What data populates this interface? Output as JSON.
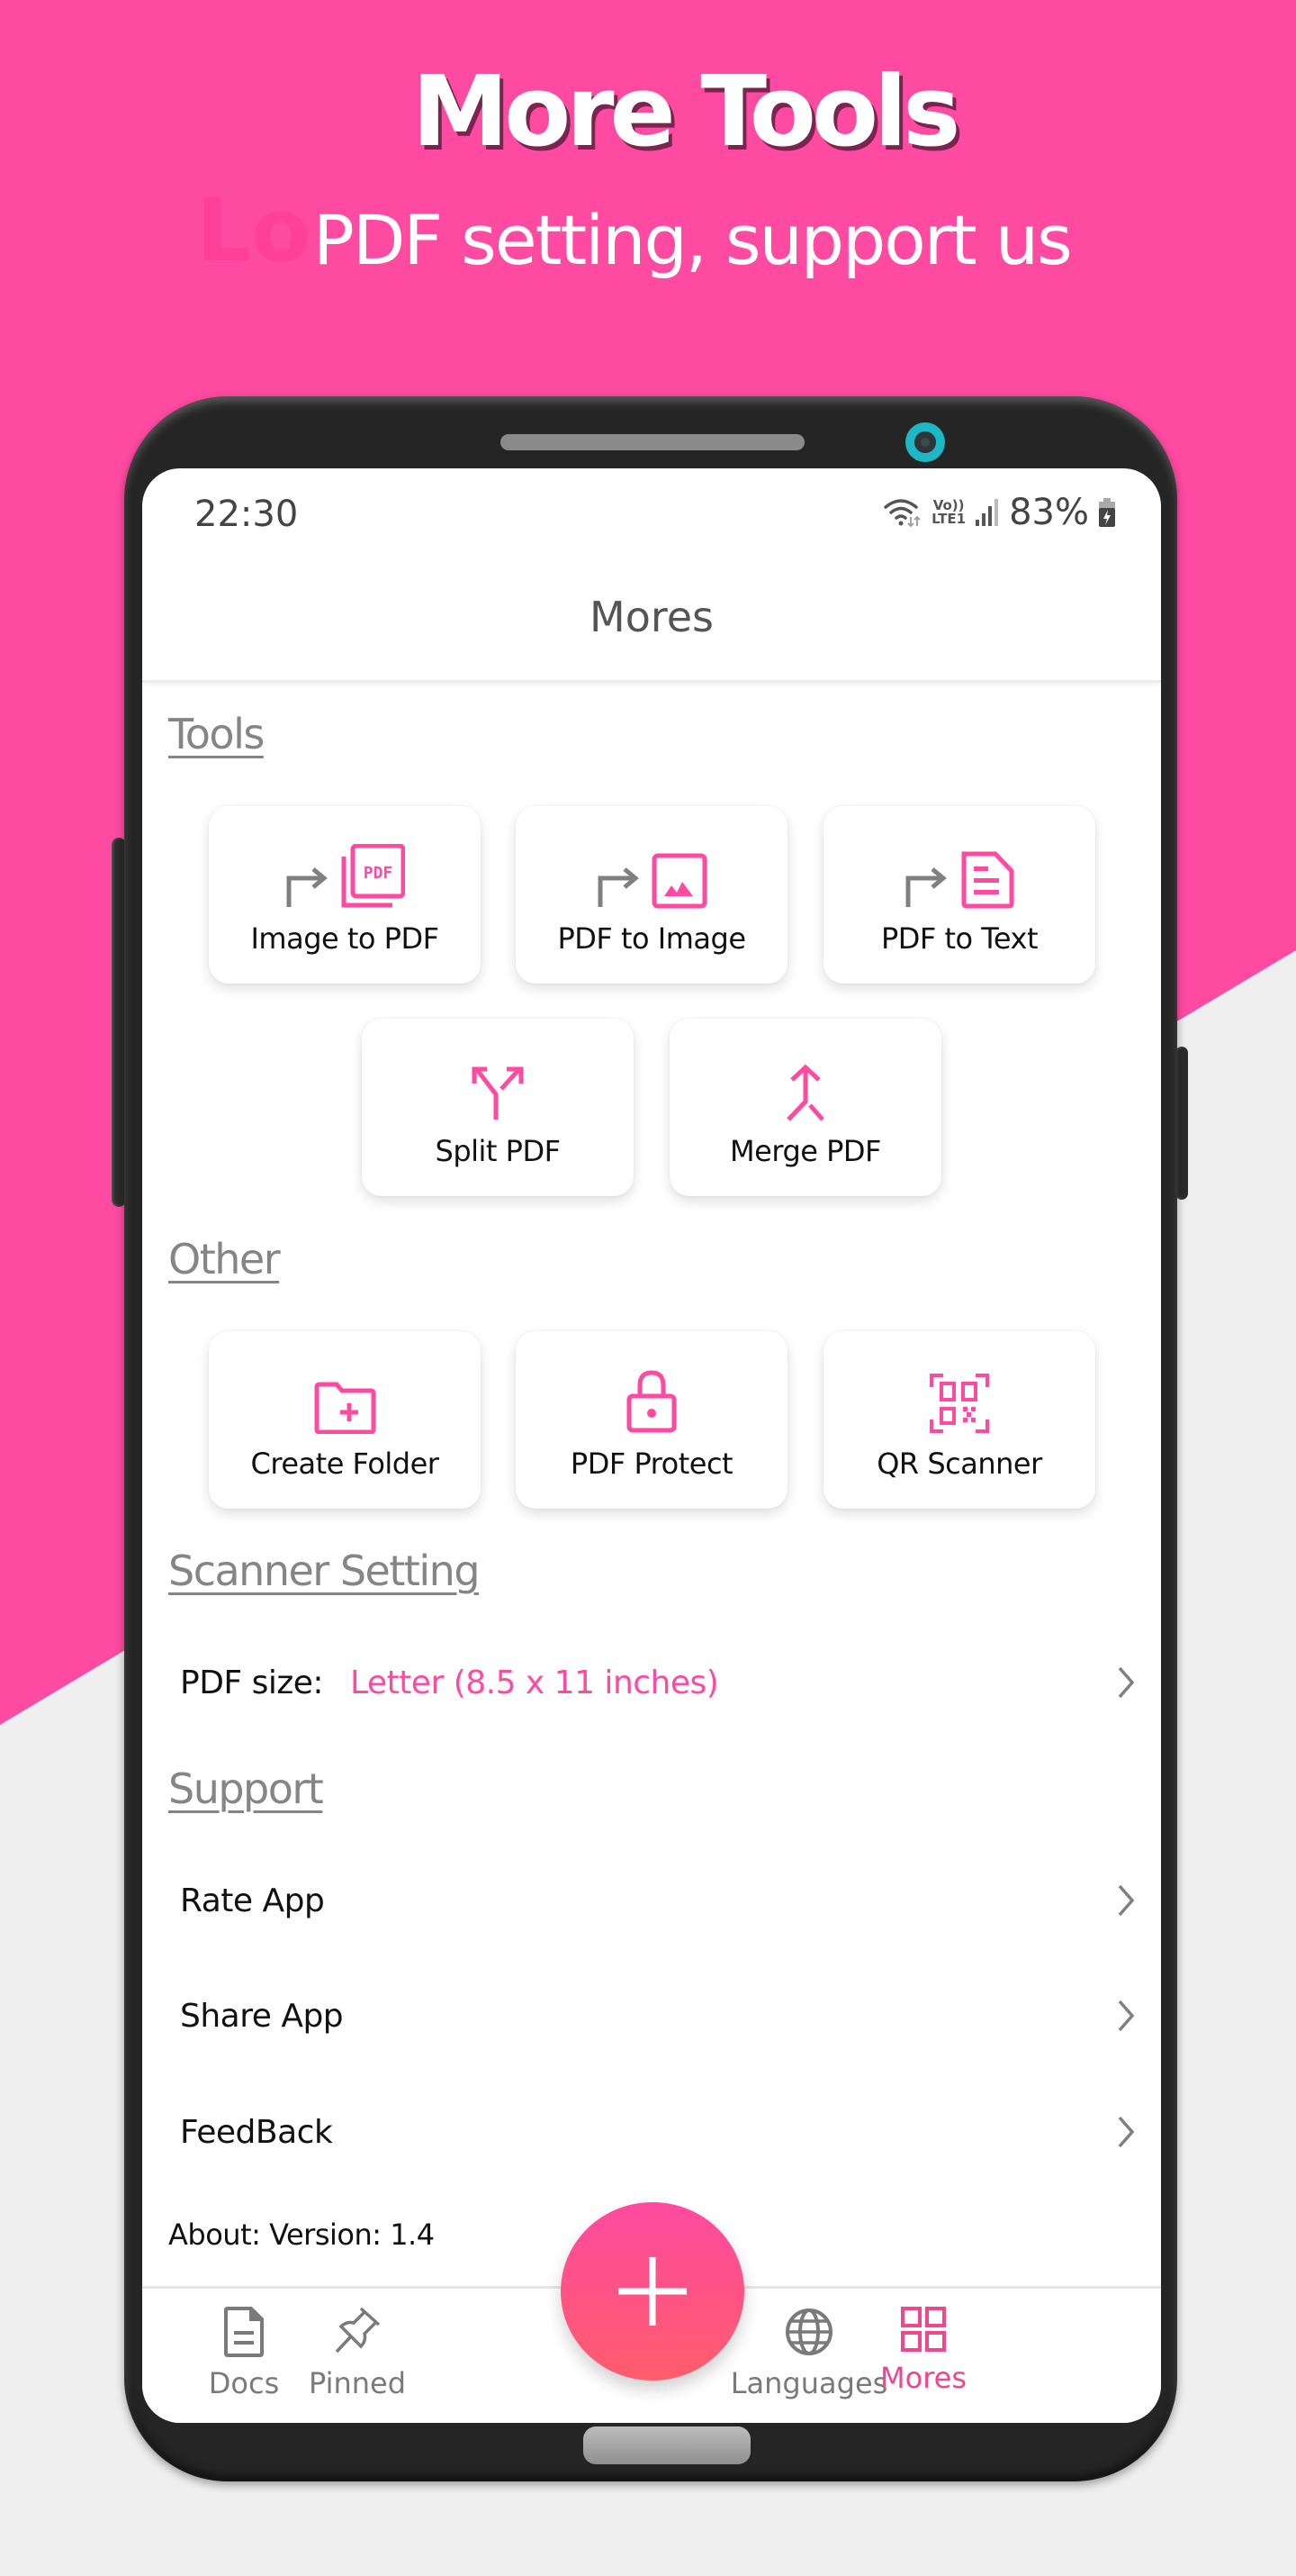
{
  "hero": {
    "title": "More Tools",
    "ghost_text": "Lo",
    "subtitle": "PDF setting, support us"
  },
  "status_bar": {
    "time": "22:30",
    "network_label_top": "Vo))",
    "network_label_bottom": "LTE1",
    "battery_percent": "83%",
    "icons": [
      "wifi-icon",
      "volte-lte-icon",
      "signal-icon",
      "battery-charging-icon"
    ]
  },
  "header": {
    "title": "Mores"
  },
  "sections": {
    "tools": {
      "title": "Tools",
      "items": [
        {
          "label": "Image to PDF",
          "icon": "image-to-pdf-icon"
        },
        {
          "label": "PDF to Image",
          "icon": "pdf-to-image-icon"
        },
        {
          "label": "PDF to Text",
          "icon": "pdf-to-text-icon"
        },
        {
          "label": "Split PDF",
          "icon": "split-icon"
        },
        {
          "label": "Merge PDF",
          "icon": "merge-icon"
        }
      ]
    },
    "other": {
      "title": "Other",
      "items": [
        {
          "label": "Create Folder",
          "icon": "create-folder-icon"
        },
        {
          "label": "PDF Protect",
          "icon": "lock-icon"
        },
        {
          "label": "QR Scanner",
          "icon": "qr-scanner-icon"
        }
      ]
    },
    "scanner_setting": {
      "title": "Scanner Setting",
      "pdf_size_label": "PDF size:",
      "pdf_size_value": "Letter (8.5 x 11 inches)"
    },
    "support": {
      "title": "Support",
      "items": [
        {
          "label": "Rate App"
        },
        {
          "label": "Share App"
        },
        {
          "label": "FeedBack"
        }
      ]
    },
    "about": "About: Version: 1.4"
  },
  "bottom_nav": {
    "items": [
      {
        "label": "Docs",
        "icon": "document-icon",
        "active": false
      },
      {
        "label": "Pinned",
        "icon": "pin-icon",
        "active": false
      },
      {
        "label": "Languages",
        "icon": "globe-icon",
        "active": false
      },
      {
        "label": "Mores",
        "icon": "grid-icon",
        "active": true
      }
    ],
    "fab_icon": "plus-icon"
  },
  "colors": {
    "accent": "#ff4aa2",
    "background_light": "#efefef",
    "fab_gradient_top": "#ff4aa0",
    "fab_gradient_bottom": "#ff5c6c",
    "section_title": "#858585",
    "inactive_nav": "#7a7a7a"
  }
}
